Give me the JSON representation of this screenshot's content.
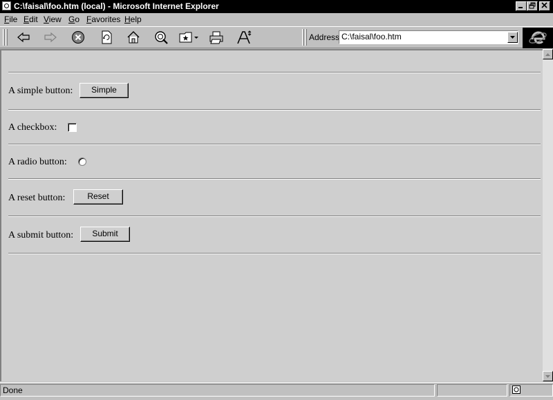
{
  "window": {
    "title": "C:\\faisal\\foo.htm (local) - Microsoft Internet Explorer",
    "caption_buttons": [
      "minimize",
      "restore",
      "close"
    ]
  },
  "menu": {
    "items": [
      {
        "label": "File",
        "accel": "F",
        "rest": "ile"
      },
      {
        "label": "Edit",
        "accel": "E",
        "rest": "dit"
      },
      {
        "label": "View",
        "accel": "V",
        "rest": "iew"
      },
      {
        "label": "Go",
        "accel": "G",
        "rest": "o"
      },
      {
        "label": "Favorites",
        "accel": "F",
        "rest": "avorites"
      },
      {
        "label": "Help",
        "accel": "H",
        "rest": "elp"
      }
    ]
  },
  "toolbar": {
    "icons": [
      "back-icon",
      "forward-icon",
      "stop-icon",
      "refresh-icon",
      "home-icon",
      "search-icon",
      "favorites-icon",
      "print-icon",
      "font-icon"
    ],
    "address_label": "Address",
    "address_value": "C:\\faisal\\foo.htm"
  },
  "content": {
    "rows": [
      {
        "label": "A simple button:",
        "control": "button",
        "value": "Simple"
      },
      {
        "label": "A checkbox:",
        "control": "checkbox",
        "checked": false
      },
      {
        "label": "A radio button:",
        "control": "radio",
        "checked": false
      },
      {
        "label": "A reset button:",
        "control": "button",
        "value": "Reset"
      },
      {
        "label": "A submit button:",
        "control": "button",
        "value": "Submit"
      }
    ]
  },
  "status": {
    "text": "Done",
    "zone_icon": "local-zone-icon"
  },
  "colors": {
    "titlebar_bg": "#000000",
    "chrome_bg": "#c0c0c0",
    "content_bg": "#cfcfcf"
  }
}
